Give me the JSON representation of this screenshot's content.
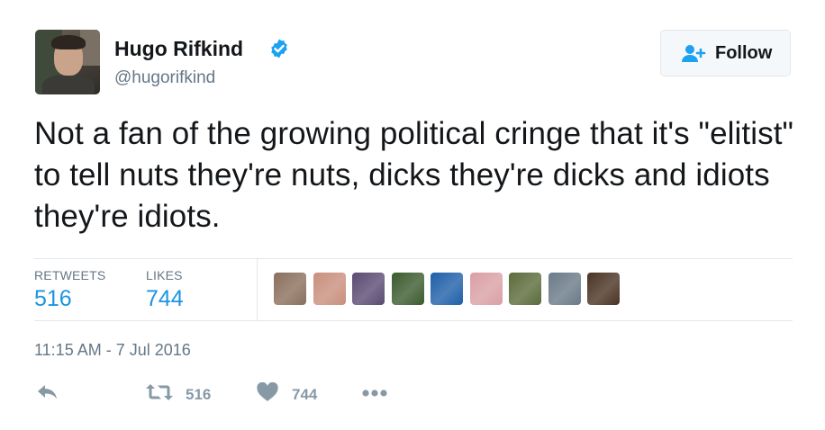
{
  "author": {
    "name": "Hugo Rifkind",
    "handle": "@hugorifkind",
    "verified": true
  },
  "follow_button": {
    "label": "Follow",
    "icon": "add-user-icon"
  },
  "tweet": {
    "text": "Not a fan of the growing political cringe that it's \"elitist\" to tell nuts they're nuts, dicks they're dicks and idiots they're idiots."
  },
  "stats": {
    "retweets_label": "RETWEETS",
    "retweets_value": "516",
    "likes_label": "LIKES",
    "likes_value": "744"
  },
  "likers": [
    {
      "icon": "liker-avatar-1",
      "color": "#8a6f5c"
    },
    {
      "icon": "liker-avatar-2",
      "color": "#c98f7d"
    },
    {
      "icon": "liker-avatar-3",
      "color": "#5b4a72"
    },
    {
      "icon": "liker-avatar-4",
      "color": "#3b5b2e"
    },
    {
      "icon": "liker-avatar-5",
      "color": "#1f5fa8"
    },
    {
      "icon": "liker-avatar-6",
      "color": "#d9a0a5"
    },
    {
      "icon": "liker-avatar-7",
      "color": "#5a6b3a"
    },
    {
      "icon": "liker-avatar-8",
      "color": "#6a7a88"
    },
    {
      "icon": "liker-avatar-9",
      "color": "#4a3324"
    }
  ],
  "timestamp": "11:15 AM - 7 Jul 2016",
  "actions": {
    "reply_icon": "reply-icon",
    "retweet_icon": "retweet-icon",
    "retweet_count": "516",
    "like_icon": "heart-icon",
    "like_count": "744",
    "more_icon": "more-icon"
  },
  "colors": {
    "link": "#1b95e0",
    "muted": "#657786",
    "action": "#8899a6",
    "verified": "#1da1f2"
  }
}
